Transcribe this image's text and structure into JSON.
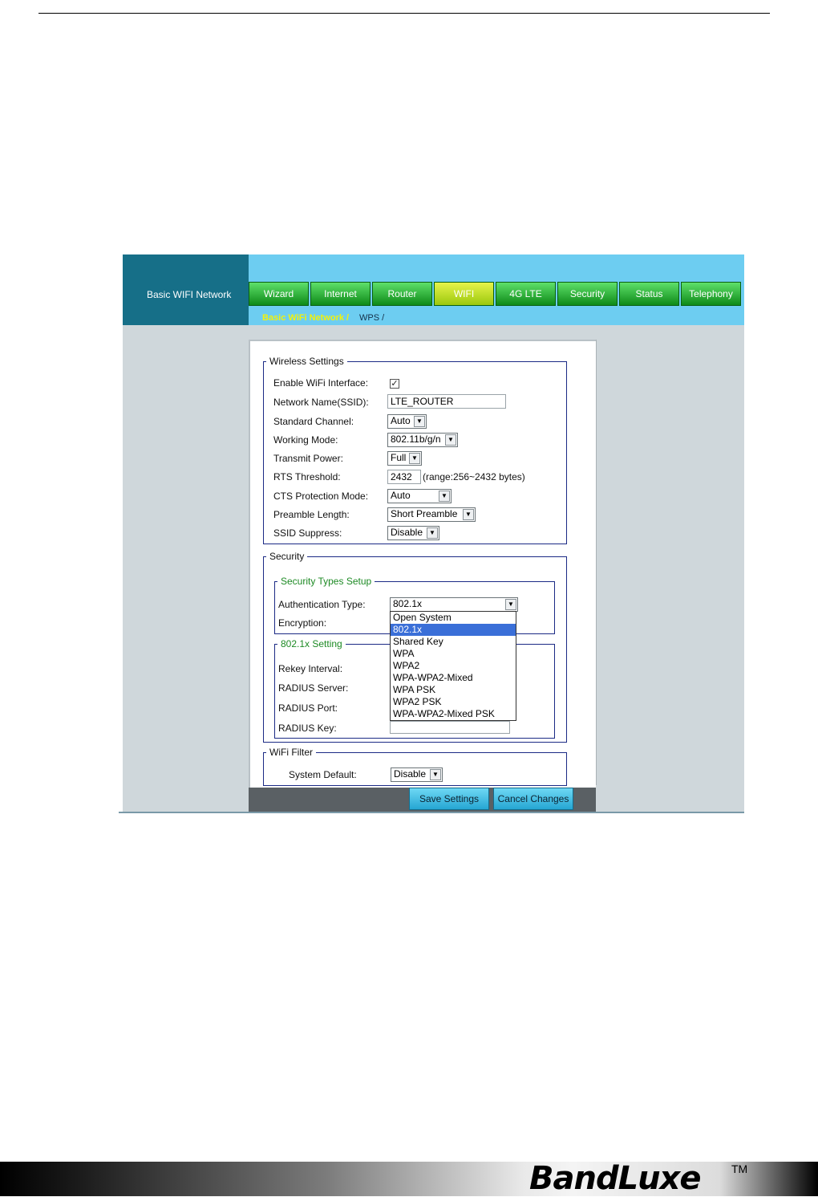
{
  "header": {
    "title": "Basic WIFI Network"
  },
  "tabs": [
    "Wizard",
    "Internet",
    "Router",
    "WIFI",
    "4G LTE",
    "Security",
    "Status",
    "Telephony"
  ],
  "active_tab": "WIFI",
  "breadcrumb": {
    "current": "Basic WiFi Network  /",
    "next": "WPS  /"
  },
  "wireless": {
    "legend": "Wireless Settings",
    "enable_label": "Enable WiFi Interface:",
    "enable_checked": "✓",
    "ssid_label": "Network Name(SSID):",
    "ssid_value": "LTE_ROUTER",
    "channel_label": "Standard Channel:",
    "channel_value": "Auto",
    "mode_label": "Working Mode:",
    "mode_value": "802.11b/g/n",
    "power_label": "Transmit Power:",
    "power_value": "Full",
    "rts_label": "RTS Threshold:",
    "rts_value": "2432",
    "rts_hint": "(range:256~2432 bytes)",
    "cts_label": "CTS Protection Mode:",
    "cts_value": "Auto",
    "preamble_label": "Preamble Length:",
    "preamble_value": "Short Preamble",
    "suppress_label": "SSID Suppress:",
    "suppress_value": "Disable"
  },
  "security": {
    "legend": "Security",
    "types_legend": "Security Types Setup",
    "auth_label": "Authentication Type:",
    "auth_value": "802.1x",
    "encryption_label": "Encryption:",
    "dropdown_options": [
      "Open System",
      "802.1x",
      "Shared Key",
      "WPA",
      "WPA2",
      "WPA-WPA2-Mixed",
      "WPA PSK",
      "WPA2 PSK",
      "WPA-WPA2-Mixed PSK"
    ],
    "dropdown_selected": "802.1x",
    "setting_legend": "802.1x Setting",
    "rekey_label": "Rekey Interval:",
    "radius_server_label": "RADIUS Server:",
    "radius_port_label": "RADIUS Port:",
    "radius_key_label": "RADIUS Key:"
  },
  "filter": {
    "legend": "WiFi Filter",
    "default_label": "System Default:",
    "default_value": "Disable"
  },
  "buttons": {
    "save": "Save Settings",
    "cancel": "Cancel Changes"
  },
  "brand": {
    "logo": "BandLuxe",
    "tm": "TM"
  }
}
